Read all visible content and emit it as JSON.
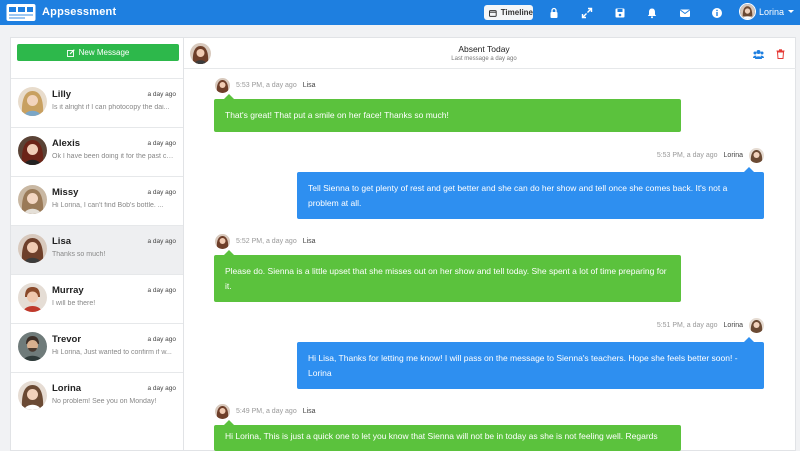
{
  "app": {
    "title": "Appsessment"
  },
  "topbar": {
    "timeline_label": "Timeline",
    "icons": [
      "lock-icon",
      "expand-icon",
      "save-icon",
      "bell-icon",
      "envelope-icon",
      "info-icon"
    ],
    "user_name": "Lorina"
  },
  "sidebar": {
    "new_message_label": "New Message",
    "conversations": [
      {
        "name": "Lilly",
        "date": "a day ago",
        "preview": "Is it alright if I can photocopy the dai..."
      },
      {
        "name": "Alexis",
        "date": "a day ago",
        "preview": "Ok I have been doing it for the past co..."
      },
      {
        "name": "Missy",
        "date": "a day ago",
        "preview": "Hi Lorina, I can't find Bob's bottle. ..."
      },
      {
        "name": "Lisa",
        "date": "a day ago",
        "preview": "Thanks so much!"
      },
      {
        "name": "Murray",
        "date": "a day ago",
        "preview": "I will be there!"
      },
      {
        "name": "Trevor",
        "date": "a day ago",
        "preview": "Hi Lorina, Just wanted to confirm if w..."
      },
      {
        "name": "Lorina",
        "date": "a day ago",
        "preview": "No problem! See you on Monday!"
      }
    ]
  },
  "chat": {
    "title": "Absent Today",
    "subtitle": "Last message a day ago",
    "messages": [
      {
        "time": "5:53 PM, a day ago",
        "author": "Lisa",
        "text": "That's great! That put a smile on her face! Thanks so much!"
      },
      {
        "time": "5:53 PM, a day ago",
        "author": "Lorina",
        "text": "Tell Sienna to get plenty of rest and get better and she can do her show and tell once she comes back. It's not a problem at all."
      },
      {
        "time": "5:52 PM, a day ago",
        "author": "Lisa",
        "text": "Please do. Sienna is a little upset that she misses out on her show and tell today. She spent a lot of time preparing for it."
      },
      {
        "time": "5:51 PM, a day ago",
        "author": "Lorina",
        "text": "Hi Lisa, Thanks for letting me know! I will pass on the message to Sienna's teachers. Hope she feels better soon! - Lorina"
      },
      {
        "time": "5:49 PM, a day ago",
        "author": "Lisa",
        "text": "Hi Lorina, This is just a quick one to let you know that Sienna will not be in today as she is not feeling well. Regards"
      }
    ]
  },
  "colors": {
    "topbar": "#1e7fe0",
    "new_message_button": "#2db84b",
    "incoming_bubble": "#5bc23d",
    "outgoing_bubble": "#2e8ff0",
    "delete_icon": "#e53935"
  }
}
